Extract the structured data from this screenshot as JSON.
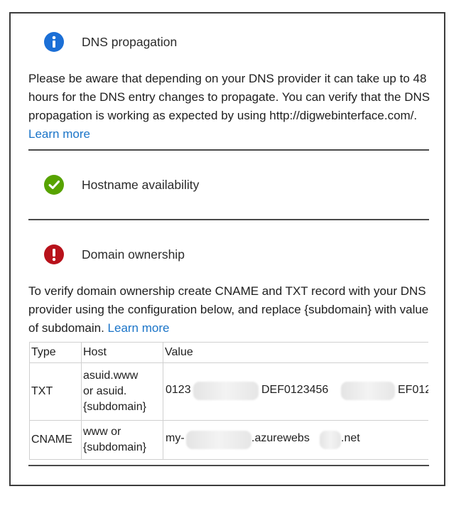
{
  "sections": {
    "dns": {
      "icon": "info-icon",
      "title": "DNS propagation",
      "body": "Please be aware that depending on your DNS provider it can take up to 48 hours for the DNS entry changes to propagate. You can verify that the DNS propagation is working as expected by using http://digwebinterface.com/.",
      "link": "Learn more"
    },
    "hostname": {
      "icon": "checkmark-icon",
      "title": "Hostname availability"
    },
    "ownership": {
      "icon": "error-icon",
      "title": "Domain ownership",
      "body": "To verify domain ownership create CNAME and TXT record with your DNS provider using the configuration below, and replace {subdomain} with value of subdomain.",
      "link": "Learn more"
    }
  },
  "table": {
    "headers": [
      "Type",
      "Host",
      "Value"
    ],
    "rows": [
      {
        "type": "TXT",
        "host": [
          "asuid.www",
          "or asuid.",
          "{subdomain}"
        ],
        "value_parts": [
          "0123",
          "DEF0123456",
          "EF012"
        ]
      },
      {
        "type": "CNAME",
        "host": [
          "www or",
          "{subdomain}"
        ],
        "value_parts": [
          "my-",
          ".azurewebs",
          ".net"
        ]
      }
    ]
  },
  "colors": {
    "info": "#1b6fd6",
    "success": "#57a300",
    "error": "#b8121b",
    "link": "#1a74c8"
  }
}
